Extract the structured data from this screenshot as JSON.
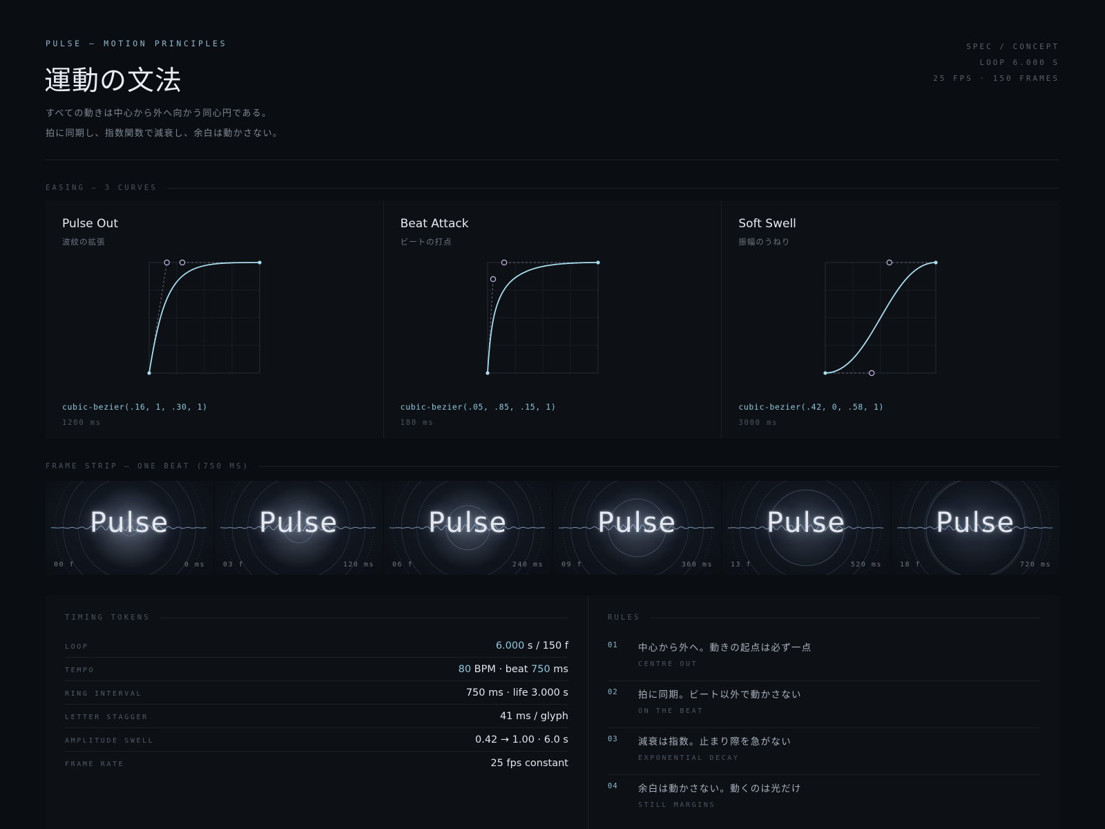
{
  "header": {
    "eyebrow": "PULSE — MOTION PRINCIPLES",
    "title": "運動の文法",
    "lede": [
      "すべての動きは中心から外へ向かう同心円である。",
      "拍に同期し、指数関数で減衰し、余白は動かさない。"
    ],
    "spec": [
      "SPEC / CONCEPT",
      "LOOP 6.000 S",
      "25 FPS · 150 FRAMES"
    ]
  },
  "sections": {
    "easing": "EASING — 3 CURVES",
    "strip": "FRAME STRIP — ONE BEAT (750 MS)",
    "tokens": "TIMING TOKENS",
    "rules": "RULES"
  },
  "curves": [
    {
      "name": "Pulse Out",
      "subtitle": "波紋の拡張",
      "bezier": "cubic-bezier(.16, 1, .30, 1)",
      "duration": "1200 ms",
      "points": [
        0.16,
        1,
        0.3,
        1
      ]
    },
    {
      "name": "Beat Attack",
      "subtitle": "ビートの打点",
      "bezier": "cubic-bezier(.05, .85, .15, 1)",
      "duration": "180 ms",
      "points": [
        0.05,
        0.85,
        0.15,
        1
      ]
    },
    {
      "name": "Soft Swell",
      "subtitle": "振幅のうねり",
      "bezier": "cubic-bezier(.42, 0, .58, 1)",
      "duration": "3000 ms",
      "points": [
        0.42,
        0,
        0.58,
        1
      ]
    }
  ],
  "frames": [
    {
      "word": "Pulse",
      "frame": "00 f",
      "time": "0 ms",
      "progress": 0
    },
    {
      "word": "Pulse",
      "frame": "03 f",
      "time": "120 ms",
      "progress": 0.16
    },
    {
      "word": "Pulse",
      "frame": "06 f",
      "time": "240 ms",
      "progress": 0.32
    },
    {
      "word": "Pulse",
      "frame": "09 f",
      "time": "360 ms",
      "progress": 0.48
    },
    {
      "word": "Pulse",
      "frame": "13 f",
      "time": "520 ms",
      "progress": 0.69
    },
    {
      "word": "Pulse",
      "frame": "18 f",
      "time": "720 ms",
      "progress": 0.96
    }
  ],
  "tokens": [
    {
      "key": "LOOP",
      "parts": [
        {
          "t": "6.000",
          "accent": true
        },
        {
          "t": " s / 150 f"
        }
      ]
    },
    {
      "key": "TEMPO",
      "parts": [
        {
          "t": "80",
          "accent": true
        },
        {
          "t": " BPM · beat "
        },
        {
          "t": "750",
          "accent": true
        },
        {
          "t": " ms"
        }
      ]
    },
    {
      "key": "RING INTERVAL",
      "parts": [
        {
          "t": "750 ms · life 3.000 s"
        }
      ]
    },
    {
      "key": "LETTER STAGGER",
      "parts": [
        {
          "t": "41 ms / glyph"
        }
      ]
    },
    {
      "key": "AMPLITUDE SWELL",
      "parts": [
        {
          "t": "0.42 → 1.00 · 6.0 s"
        }
      ]
    },
    {
      "key": "FRAME RATE",
      "parts": [
        {
          "t": "25 fps constant"
        }
      ]
    }
  ],
  "rules": [
    {
      "num": "01",
      "text": "中心から外へ。動きの起点は必ず一点",
      "sub": "CENTRE OUT"
    },
    {
      "num": "02",
      "text": "拍に同期。ビート以外で動かさない",
      "sub": "ON THE BEAT"
    },
    {
      "num": "03",
      "text": "減衰は指数。止まり際を急がない",
      "sub": "EXPONENTIAL DECAY"
    },
    {
      "num": "04",
      "text": "余白は動かさない。動くのは光だけ",
      "sub": "STILL MARGINS"
    }
  ],
  "colors": {
    "background": "#0a0d11",
    "panel": "#0d1116",
    "accent": "#8fc7da",
    "handle": "#c7b7e6",
    "curve": "#a9dcec"
  }
}
